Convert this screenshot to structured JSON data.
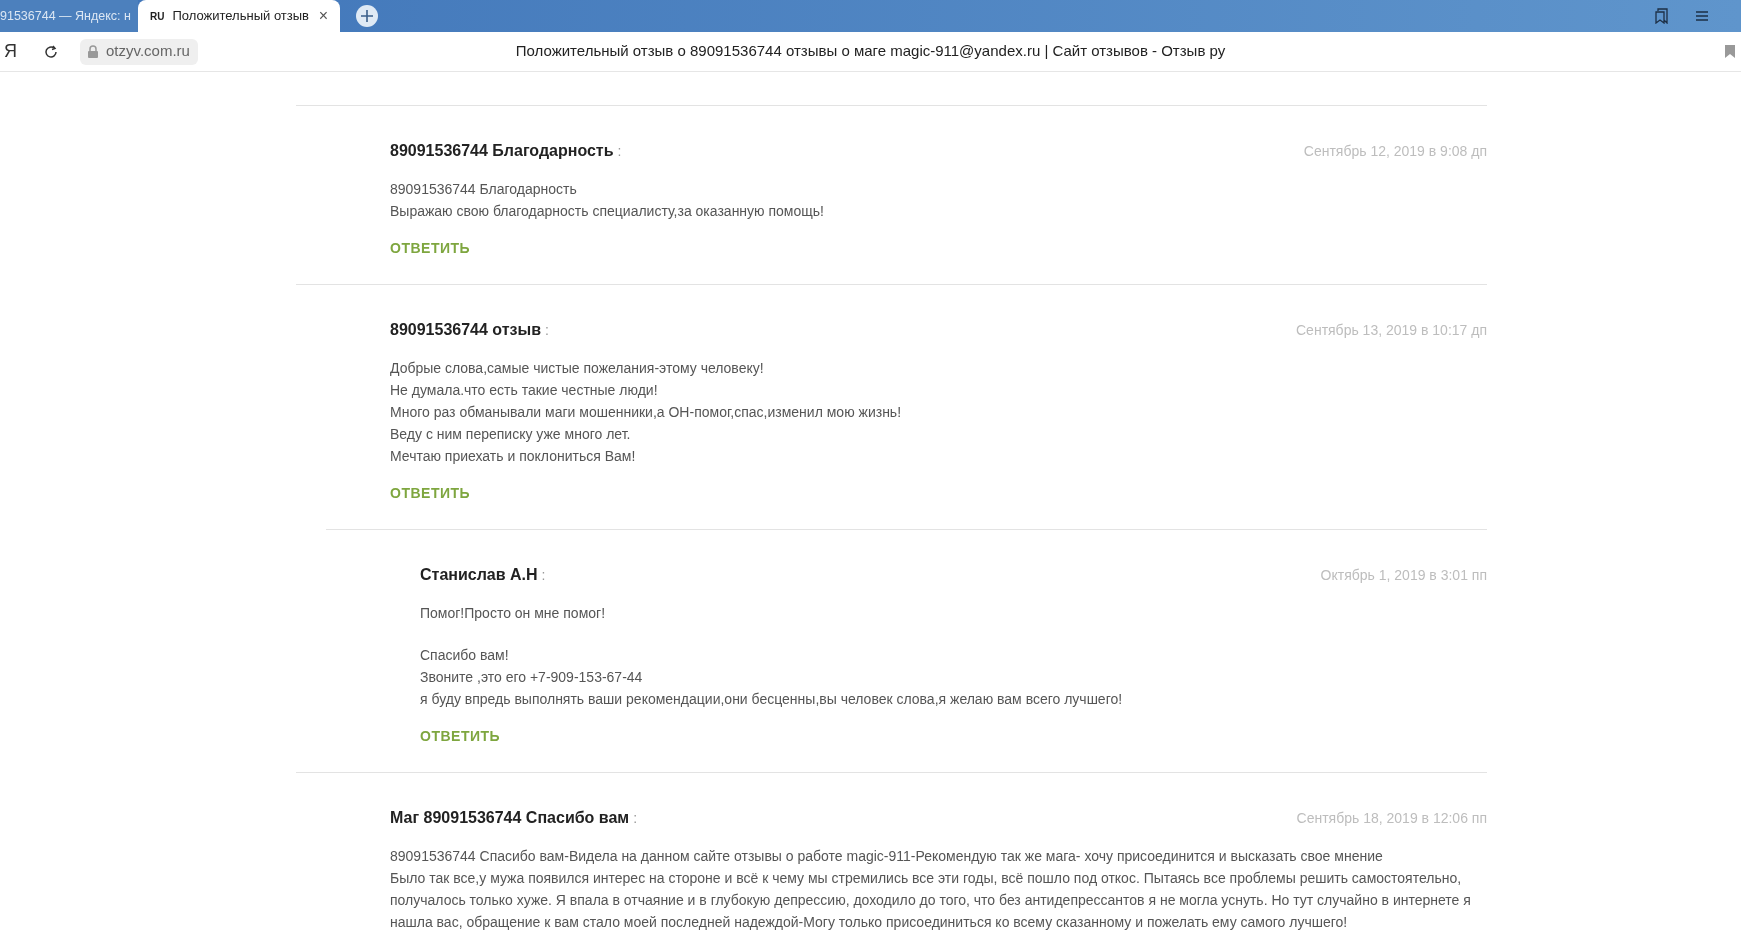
{
  "browser": {
    "tabs": [
      {
        "title": "91536744 — Яндекс: н",
        "selected": false
      },
      {
        "favicon": "RU",
        "title": "Положительный отзыв",
        "close": "×",
        "selected": true
      }
    ],
    "address": {
      "domain": "otzyv.com.ru",
      "page_title": "Положительный отзыв о 89091536744 отзывы о маге magic-911@yandex.ru | Сайт отзывов - Отзыв ру"
    },
    "logo": "Я"
  },
  "comments": [
    {
      "author": "89091536744 Благодарность",
      "suffix": ":",
      "date": "Сентябрь 12, 2019 в 9:08 дп",
      "nested": false,
      "paragraphs": [
        [
          "89091536744 Благодарность",
          "Выражаю свою благодарность специалисту,за оказанную помощь!"
        ]
      ],
      "reply": "ОТВЕТИТЬ"
    },
    {
      "author": "89091536744 отзыв",
      "suffix": ":",
      "date": "Сентябрь 13, 2019 в 10:17 дп",
      "nested": false,
      "paragraphs": [
        [
          "Добрые слова,самые чистые пожелания-этому человеку!",
          "Не думала.что есть такие честные люди!",
          "Много раз обманывали маги мошенники,а ОН-помог,спас,изменил мою жизнь!",
          "Веду с ним переписку уже много лет.",
          "Мечтаю приехать и поклониться Вам!"
        ]
      ],
      "reply": "ОТВЕТИТЬ"
    },
    {
      "author": "Станислав А.Н",
      "suffix": ":",
      "date": "Октябрь 1, 2019 в 3:01 пп",
      "nested": true,
      "paragraphs": [
        [
          "Помог!Просто он мне помог!"
        ],
        [
          "Спасибо вам!",
          "Звоните ,это его +7-909-153-67-44",
          "я буду впредь выполнять ваши рекомендации,они бесценны,вы человек слова,я желаю вам всего лучшего!"
        ]
      ],
      "reply": "ОТВЕТИТЬ"
    },
    {
      "author": "Маг 89091536744 Спасибо вам",
      "suffix": ":",
      "date": "Сентябрь 18, 2019 в 12:06 пп",
      "nested": false,
      "paragraphs": [
        [
          "89091536744 Спасибо вам-Видела на данном сайте отзывы о работе magic-911-Рекомендую так же мага- хочу присоединится и высказать свое мнение",
          "Было так все,у мужа появился интерес на стороне и всё к чему мы стремились все эти годы, всё пошло под откос. Пытаясь все проблемы решить самостоятельно, получалось только хуже. Я впала в отчаяние и в глубокую депрессию, доходило до того, что без антидепрессантов я не могла уснуть. Но тут случайно в интернете я нашла вас, обращение к вам стало моей последней надеждой-Могу только присоединиться ко всему сказанному и пожелать ему самого лучшего!"
        ]
      ]
    }
  ]
}
